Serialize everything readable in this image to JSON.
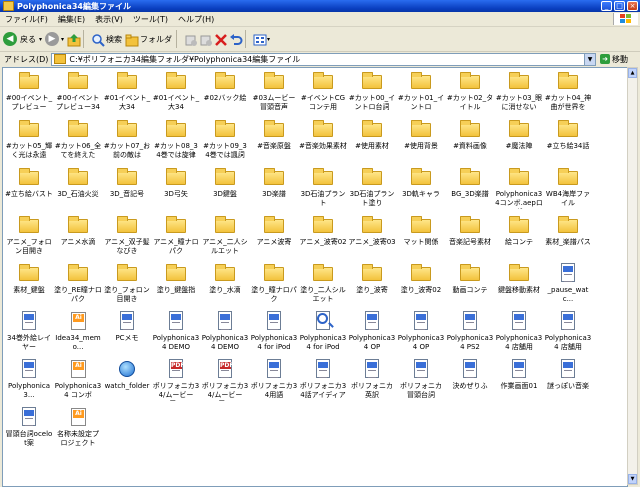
{
  "window": {
    "title": "Polyphonica34編集ファイル"
  },
  "menu": [
    "ファイル(F)",
    "編集(E)",
    "表示(V)",
    "ツール(T)",
    "ヘルプ(H)"
  ],
  "toolbar": {
    "back": "戻る",
    "search": "検索",
    "folders": "フォルダ"
  },
  "address": {
    "label": "アドレス(D)",
    "path": "C:¥ポリフォニカ34編集フォルダ¥Polyphonica34編集ファイル",
    "go": "移動"
  },
  "items": [
    {
      "label": "#00イベント_プレビュー",
      "type": "folder"
    },
    {
      "label": "#00イベントプレビュー34",
      "type": "folder"
    },
    {
      "label": "#01イベント_大34",
      "type": "folder"
    },
    {
      "label": "#01イベント_大34",
      "type": "folder"
    },
    {
      "label": "#02バック絵",
      "type": "folder"
    },
    {
      "label": "#03ムービー冒頭音声",
      "type": "folder"
    },
    {
      "label": "#イベントCGコンテ用",
      "type": "folder"
    },
    {
      "label": "#カット00_イントロ台詞",
      "type": "folder"
    },
    {
      "label": "#カット01_イントロ",
      "type": "folder"
    },
    {
      "label": "#カット02_タイトル",
      "type": "folder"
    },
    {
      "label": "#カット03_眼に消せない",
      "type": "folder"
    },
    {
      "label": "#カット04_神曲が世界を",
      "type": "folder"
    },
    {
      "label": "#カット05_輝く光は永遠",
      "type": "folder"
    },
    {
      "label": "#カット06_全てを終えた",
      "type": "folder"
    },
    {
      "label": "#カット07_お前の敵は",
      "type": "folder"
    },
    {
      "label": "#カット08_34巻では旋律",
      "type": "folder"
    },
    {
      "label": "#カット09_34巻では諷詞",
      "type": "folder"
    },
    {
      "label": "#音楽原盤",
      "type": "folder"
    },
    {
      "label": "#音楽効果素材",
      "type": "folder"
    },
    {
      "label": "#使用素材",
      "type": "folder"
    },
    {
      "label": "#使用背景",
      "type": "folder"
    },
    {
      "label": "#資料画像",
      "type": "folder"
    },
    {
      "label": "#魔法陣",
      "type": "folder"
    },
    {
      "label": "#立ち絵34話",
      "type": "folder"
    },
    {
      "label": "#立ち絵バスト",
      "type": "folder"
    },
    {
      "label": "3D_石油火災",
      "type": "folder"
    },
    {
      "label": "3D_音記号",
      "type": "folder"
    },
    {
      "label": "3D弓矢",
      "type": "folder"
    },
    {
      "label": "3D鍵盤",
      "type": "folder"
    },
    {
      "label": "3D楽譜",
      "type": "folder"
    },
    {
      "label": "3D石油プラント",
      "type": "folder"
    },
    {
      "label": "3D石油プラント塗り",
      "type": "folder"
    },
    {
      "label": "3D軌キャラ",
      "type": "folder"
    },
    {
      "label": "BG_3D楽譜",
      "type": "folder"
    },
    {
      "label": "Polyphonica34コンボ.aepログ",
      "type": "folder"
    },
    {
      "label": "WB4海岸ファイル",
      "type": "folder"
    },
    {
      "label": "アニメ_フォロン目開き",
      "type": "folder"
    },
    {
      "label": "アニメ水滴",
      "type": "folder"
    },
    {
      "label": "アニメ_双子髪なびき",
      "type": "folder"
    },
    {
      "label": "アニメ_瞳ナロパク",
      "type": "folder"
    },
    {
      "label": "アニメ_二人シルエット",
      "type": "folder"
    },
    {
      "label": "アニメ波寄",
      "type": "folder"
    },
    {
      "label": "アニメ_波寄02",
      "type": "folder"
    },
    {
      "label": "アニメ_波寄03",
      "type": "folder"
    },
    {
      "label": "マット関係",
      "type": "folder"
    },
    {
      "label": "音楽記号素材",
      "type": "folder"
    },
    {
      "label": "絵コンテ",
      "type": "folder"
    },
    {
      "label": "素材_楽譜パス",
      "type": "folder"
    },
    {
      "label": "素材_鍵盤",
      "type": "folder"
    },
    {
      "label": "塗り_RE瞳ナロパク",
      "type": "folder"
    },
    {
      "label": "塗り_フォロン目開き",
      "type": "folder"
    },
    {
      "label": "塗り_鍵盤指",
      "type": "folder"
    },
    {
      "label": "塗り_水滴",
      "type": "folder"
    },
    {
      "label": "塗り_瞳ナロパク",
      "type": "folder"
    },
    {
      "label": "塗り_二人シルエット",
      "type": "folder"
    },
    {
      "label": "塗り_波寄",
      "type": "folder"
    },
    {
      "label": "塗り_波寄02",
      "type": "folder"
    },
    {
      "label": "動画コンテ",
      "type": "folder"
    },
    {
      "label": "鍵盤移動素材",
      "type": "folder"
    },
    {
      "label": "_pause_watc...",
      "type": "doc"
    },
    {
      "label": "34巻外絵レイヤー",
      "type": "doc"
    },
    {
      "label": "Idea34_memo...",
      "type": "ai"
    },
    {
      "label": "PCメモ",
      "type": "doc"
    },
    {
      "label": "Polyphonica34 DEMO",
      "type": "doc"
    },
    {
      "label": "Polyphonica34 DEMO",
      "type": "doc"
    },
    {
      "label": "Polyphonica34 for iPod",
      "type": "doc"
    },
    {
      "label": "Polyphonica34 for iPod",
      "type": "magn"
    },
    {
      "label": "Polyphonica34 OP",
      "type": "doc"
    },
    {
      "label": "Polyphonica34 OP",
      "type": "doc"
    },
    {
      "label": "Polyphonica34 PS2",
      "type": "doc"
    },
    {
      "label": "Polyphonica34 店舗用",
      "type": "doc"
    },
    {
      "label": "Polyphonica34 店舗用",
      "type": "doc"
    },
    {
      "label": "Polyphonica3...",
      "type": "doc"
    },
    {
      "label": "Polyphonica34 コンボ",
      "type": "ai"
    },
    {
      "label": "watch_folder",
      "type": "globe"
    },
    {
      "label": "ポリフォニカ34/ムービー用...",
      "type": "pdf"
    },
    {
      "label": "ポリフォニカ34/ムービー用...",
      "type": "pdf"
    },
    {
      "label": "ポリフォニカ34用語",
      "type": "doc"
    },
    {
      "label": "ポリフォニカ34話アイディアメモ",
      "type": "doc"
    },
    {
      "label": "ポリフォニカ英訳",
      "type": "doc"
    },
    {
      "label": "ポリフォニカ冒頭台詞",
      "type": "doc"
    },
    {
      "label": "決めぜりふ",
      "type": "doc"
    },
    {
      "label": "作業画面01",
      "type": "doc"
    },
    {
      "label": "謎っぽい音楽",
      "type": "doc"
    },
    {
      "label": "冒頭台詞ocelot案",
      "type": "doc"
    },
    {
      "label": "名称未設定プロジェクトの...",
      "type": "ai"
    }
  ]
}
